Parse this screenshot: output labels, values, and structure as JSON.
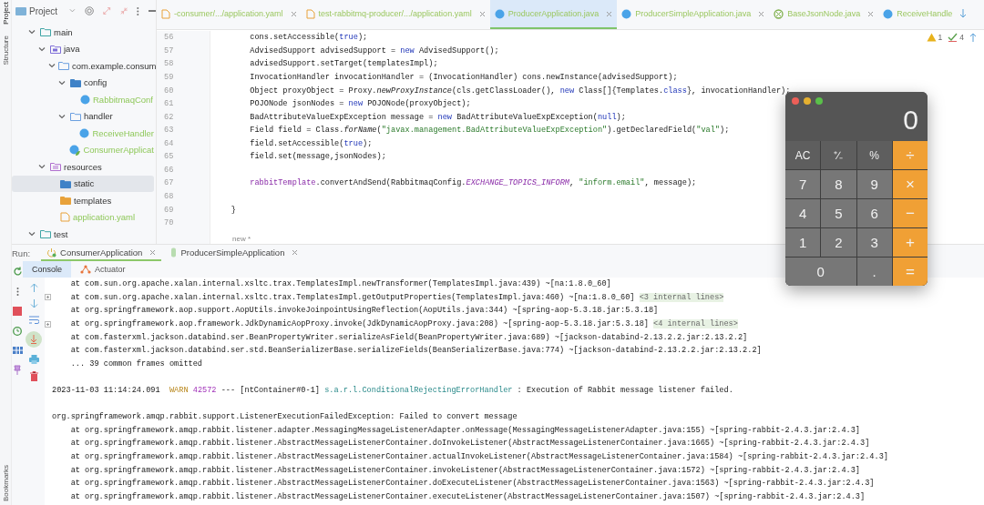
{
  "tool_strip": {
    "top": [
      "Project",
      "Structure"
    ],
    "bottom": [
      "Bookmarks"
    ]
  },
  "project_panel": {
    "title": "Project",
    "tree": [
      {
        "label": "main",
        "kind": "module",
        "expanded": true,
        "selected": false,
        "children": [
          {
            "label": "java",
            "kind": "sources",
            "expanded": true,
            "selected": false,
            "children": [
              {
                "label": "com.example.consum",
                "kind": "package",
                "expanded": true,
                "selected": false,
                "children": [
                  {
                    "label": "config",
                    "kind": "package-marked",
                    "expanded": true,
                    "selected": false,
                    "children": [
                      {
                        "label": "RabbitmaqConf",
                        "kind": "class",
                        "added": true,
                        "selected": false
                      }
                    ]
                  },
                  {
                    "label": "handler",
                    "kind": "package",
                    "expanded": true,
                    "selected": false,
                    "children": [
                      {
                        "label": "ReceiveHandler",
                        "kind": "class",
                        "added": true,
                        "selected": false
                      }
                    ]
                  },
                  {
                    "label": "ConsumerApplicat",
                    "kind": "app",
                    "added": true,
                    "selected": false
                  }
                ]
              }
            ]
          },
          {
            "label": "resources",
            "kind": "resources",
            "expanded": true,
            "selected": false,
            "children": [
              {
                "label": "static",
                "kind": "web-folder",
                "selected": true
              },
              {
                "label": "templates",
                "kind": "template-folder",
                "selected": false
              },
              {
                "label": "application.yaml",
                "kind": "yaml",
                "added": true,
                "selected": false
              }
            ]
          }
        ]
      },
      {
        "label": "test",
        "kind": "module",
        "expanded": true,
        "selected": false
      }
    ]
  },
  "editor_tabs": [
    {
      "label": "-consumer/.../application.yaml",
      "kind": "yaml",
      "selected": false
    },
    {
      "label": "test-rabbitmq-producer/.../application.yaml",
      "kind": "yaml",
      "selected": false
    },
    {
      "label": "ProducerApplication.java",
      "kind": "class",
      "selected": true
    },
    {
      "label": "ProducerSimpleApplication.java",
      "kind": "class",
      "selected": false
    },
    {
      "label": "BaseJsonNode.java",
      "kind": "abstract-class",
      "selected": false
    },
    {
      "label": "ReceiveHandle",
      "kind": "class",
      "selected": false
    }
  ],
  "inspections": {
    "warnings": "1",
    "weak_warnings": "4"
  },
  "code_lines": [
    {
      "number": "56",
      "segments": [
        {
          "text": "        cons.setAccessible(",
          "kind": "plain"
        },
        {
          "text": "true",
          "kind": "keyword"
        },
        {
          "text": ");",
          "kind": "plain"
        }
      ]
    },
    {
      "number": "57",
      "segments": [
        {
          "text": "        AdvisedSupport advisedSupport = ",
          "kind": "plain"
        },
        {
          "text": "new",
          "kind": "keyword"
        },
        {
          "text": " AdvisedSupport();",
          "kind": "plain"
        }
      ]
    },
    {
      "number": "58",
      "segments": [
        {
          "text": "        advisedSupport.setTarget(templatesImpl);",
          "kind": "plain"
        }
      ]
    },
    {
      "number": "59",
      "segments": [
        {
          "text": "        InvocationHandler invocationHandler = (InvocationHandler) cons.newInstance(advisedSupport);",
          "kind": "plain"
        }
      ]
    },
    {
      "number": "60",
      "segments": [
        {
          "text": "        Object proxyObject = Proxy.",
          "kind": "plain"
        },
        {
          "text": "newProxyInstance",
          "kind": "static-call"
        },
        {
          "text": "(cls.getClassLoader(), ",
          "kind": "plain"
        },
        {
          "text": "new",
          "kind": "keyword"
        },
        {
          "text": " Class[]{Templates.",
          "kind": "plain"
        },
        {
          "text": "class",
          "kind": "keyword"
        },
        {
          "text": "}, invocationHandler);",
          "kind": "plain"
        }
      ]
    },
    {
      "number": "61",
      "segments": [
        {
          "text": "        POJONode jsonNodes = ",
          "kind": "plain"
        },
        {
          "text": "new",
          "kind": "keyword"
        },
        {
          "text": " POJONode(proxyObject);",
          "kind": "plain"
        }
      ]
    },
    {
      "number": "62",
      "segments": [
        {
          "text": "        BadAttributeValueExpException message = ",
          "kind": "plain"
        },
        {
          "text": "new",
          "kind": "keyword"
        },
        {
          "text": " BadAttributeValueExpException(",
          "kind": "plain"
        },
        {
          "text": "null",
          "kind": "keyword"
        },
        {
          "text": ");",
          "kind": "plain"
        }
      ]
    },
    {
      "number": "63",
      "segments": [
        {
          "text": "        Field field = Class.",
          "kind": "plain"
        },
        {
          "text": "forName",
          "kind": "static-call"
        },
        {
          "text": "(",
          "kind": "plain"
        },
        {
          "text": "\"javax.management.BadAttributeValueExpException\"",
          "kind": "string"
        },
        {
          "text": ").getDeclaredField(",
          "kind": "plain"
        },
        {
          "text": "\"val\"",
          "kind": "string"
        },
        {
          "text": ");",
          "kind": "plain"
        }
      ]
    },
    {
      "number": "64",
      "segments": [
        {
          "text": "        field.setAccessible(",
          "kind": "plain"
        },
        {
          "text": "true",
          "kind": "keyword"
        },
        {
          "text": ");",
          "kind": "plain"
        }
      ]
    },
    {
      "number": "65",
      "segments": [
        {
          "text": "        field.set(message,jsonNodes);",
          "kind": "plain"
        }
      ]
    },
    {
      "number": "66"
    },
    {
      "number": "67",
      "segments": [
        {
          "text": "        rabbitTemplate",
          "kind": "field"
        },
        {
          "text": ".convertAndSend(RabbitmaqConfig.",
          "kind": "plain"
        },
        {
          "text": "EXCHANGE_TOPICS_INFORM",
          "kind": "static-field"
        },
        {
          "text": ", ",
          "kind": "plain"
        },
        {
          "text": "\"inform.email\"",
          "kind": "string"
        },
        {
          "text": ", message);",
          "kind": "plain"
        }
      ]
    },
    {
      "number": "68"
    },
    {
      "number": "69",
      "segments": [
        {
          "text": "    }",
          "kind": "plain"
        }
      ]
    },
    {
      "number": "70"
    }
  ],
  "author_hint": "new *",
  "run_panel": {
    "label": "Run:",
    "tabs": [
      {
        "label": "ConsumerApplication",
        "kind": "running",
        "selected": true
      },
      {
        "label": "ProducerSimpleApplication",
        "kind": "stopped",
        "selected": false
      }
    ],
    "subtabs": [
      {
        "label": "Console",
        "kind": "console",
        "selected": true
      },
      {
        "label": "Actuator",
        "kind": "actuator",
        "selected": false
      }
    ],
    "console_lines": [
      {
        "segments": [
          {
            "text": "    at com.sun.org.apache.xalan.internal.xsltc.trax.TemplatesImpl.newTransformer(TemplatesImpl.java:439) ~[na:1.8.0_60]",
            "kind": "plain"
          }
        ]
      },
      {
        "foldable": true,
        "segments": [
          {
            "text": "    at com.sun.org.apache.xalan.internal.xsltc.trax.TemplatesImpl.getOutputProperties(TemplatesImpl.java:460) ~[na:1.8.0_60] ",
            "kind": "plain"
          },
          {
            "text": "<3 internal lines>",
            "kind": "internal"
          }
        ]
      },
      {
        "segments": [
          {
            "text": "    at org.springframework.aop.support.AopUtils.invokeJoinpointUsingReflection(AopUtils.java:344) ~[spring-aop-5.3.18.jar:5.3.18]",
            "kind": "plain"
          }
        ]
      },
      {
        "foldable": true,
        "segments": [
          {
            "text": "    at org.springframework.aop.framework.JdkDynamicAopProxy.invoke(JdkDynamicAopProxy.java:208) ~[spring-aop-5.3.18.jar:5.3.18] ",
            "kind": "plain"
          },
          {
            "text": "<4 internal lines>",
            "kind": "internal"
          }
        ]
      },
      {
        "segments": [
          {
            "text": "    at com.fasterxml.jackson.databind.ser.BeanPropertyWriter.serializeAsField(BeanPropertyWriter.java:689) ~[jackson-databind-2.13.2.2.jar:2.13.2.2]",
            "kind": "plain"
          }
        ]
      },
      {
        "segments": [
          {
            "text": "    at com.fasterxml.jackson.databind.ser.std.BeanSerializerBase.serializeFields(BeanSerializerBase.java:774) ~[jackson-databind-2.13.2.2.jar:2.13.2.2]",
            "kind": "plain"
          }
        ]
      },
      {
        "segments": [
          {
            "text": "    ... 39 common frames omitted",
            "kind": "plain"
          }
        ]
      },
      {
        "kind": "blank"
      },
      {
        "kind": "text",
        "segments": [
          {
            "text": "2023-11-03 11:14:24.091  ",
            "kind": "plain"
          },
          {
            "text": "WARN",
            "kind": "warn"
          },
          {
            "text": " 42572",
            "kind": "pid"
          },
          {
            "text": " --- [ntContainer#0-1] ",
            "kind": "plain"
          },
          {
            "text": "s.a.r.l.ConditionalRejectingErrorHandler",
            "kind": "logger"
          },
          {
            "text": " : Execution of Rabbit message listener failed.",
            "kind": "plain"
          }
        ]
      },
      {
        "kind": "blank"
      },
      {
        "kind": "text",
        "segments": [
          {
            "text": "org.springframework.amqp.rabbit.support.ListenerExecutionFailedException: Failed to convert message",
            "kind": "plain"
          }
        ]
      },
      {
        "segments": [
          {
            "text": "    at org.springframework.amqp.rabbit.listener.adapter.MessagingMessageListenerAdapter.onMessage(MessagingMessageListenerAdapter.java:155) ~[spring-rabbit-2.4.3.jar:2.4.3]",
            "kind": "plain"
          }
        ]
      },
      {
        "segments": [
          {
            "text": "    at org.springframework.amqp.rabbit.listener.AbstractMessageListenerContainer.doInvokeListener(AbstractMessageListenerContainer.java:1665) ~[spring-rabbit-2.4.3.jar:2.4.3]",
            "kind": "plain"
          }
        ]
      },
      {
        "segments": [
          {
            "text": "    at org.springframework.amqp.rabbit.listener.AbstractMessageListenerContainer.actualInvokeListener(AbstractMessageListenerContainer.java:1584) ~[spring-rabbit-2.4.3.jar:2.4.3]",
            "kind": "plain"
          }
        ]
      },
      {
        "segments": [
          {
            "text": "    at org.springframework.amqp.rabbit.listener.AbstractMessageListenerContainer.invokeListener(AbstractMessageListenerContainer.java:1572) ~[spring-rabbit-2.4.3.jar:2.4.3]",
            "kind": "plain"
          }
        ]
      },
      {
        "segments": [
          {
            "text": "    at org.springframework.amqp.rabbit.listener.AbstractMessageListenerContainer.doExecuteListener(AbstractMessageListenerContainer.java:1563) ~[spring-rabbit-2.4.3.jar:2.4.3]",
            "kind": "plain"
          }
        ]
      },
      {
        "segments": [
          {
            "text": "    at org.springframework.amqp.rabbit.listener.AbstractMessageListenerContainer.executeListener(AbstractMessageListenerContainer.java:1507) ~[spring-rabbit-2.4.3.jar:2.4.3]",
            "kind": "plain"
          }
        ]
      }
    ]
  },
  "calculator": {
    "display": "0",
    "keys": [
      {
        "label": "AC",
        "kind": "function"
      },
      {
        "label": "⁺∕₋",
        "kind": "function"
      },
      {
        "label": "%",
        "kind": "function"
      },
      {
        "label": "÷",
        "kind": "operator"
      },
      {
        "label": "7",
        "kind": "digit"
      },
      {
        "label": "8",
        "kind": "digit"
      },
      {
        "label": "9",
        "kind": "digit"
      },
      {
        "label": "×",
        "kind": "operator"
      },
      {
        "label": "4",
        "kind": "digit"
      },
      {
        "label": "5",
        "kind": "digit"
      },
      {
        "label": "6",
        "kind": "digit"
      },
      {
        "label": "−",
        "kind": "operator"
      },
      {
        "label": "1",
        "kind": "digit"
      },
      {
        "label": "2",
        "kind": "digit"
      },
      {
        "label": "3",
        "kind": "digit"
      },
      {
        "label": "+",
        "kind": "operator"
      },
      {
        "label": "0",
        "kind": "digit",
        "wide": true
      },
      {
        "label": ".",
        "kind": "digit"
      },
      {
        "label": "=",
        "kind": "operator"
      }
    ]
  }
}
